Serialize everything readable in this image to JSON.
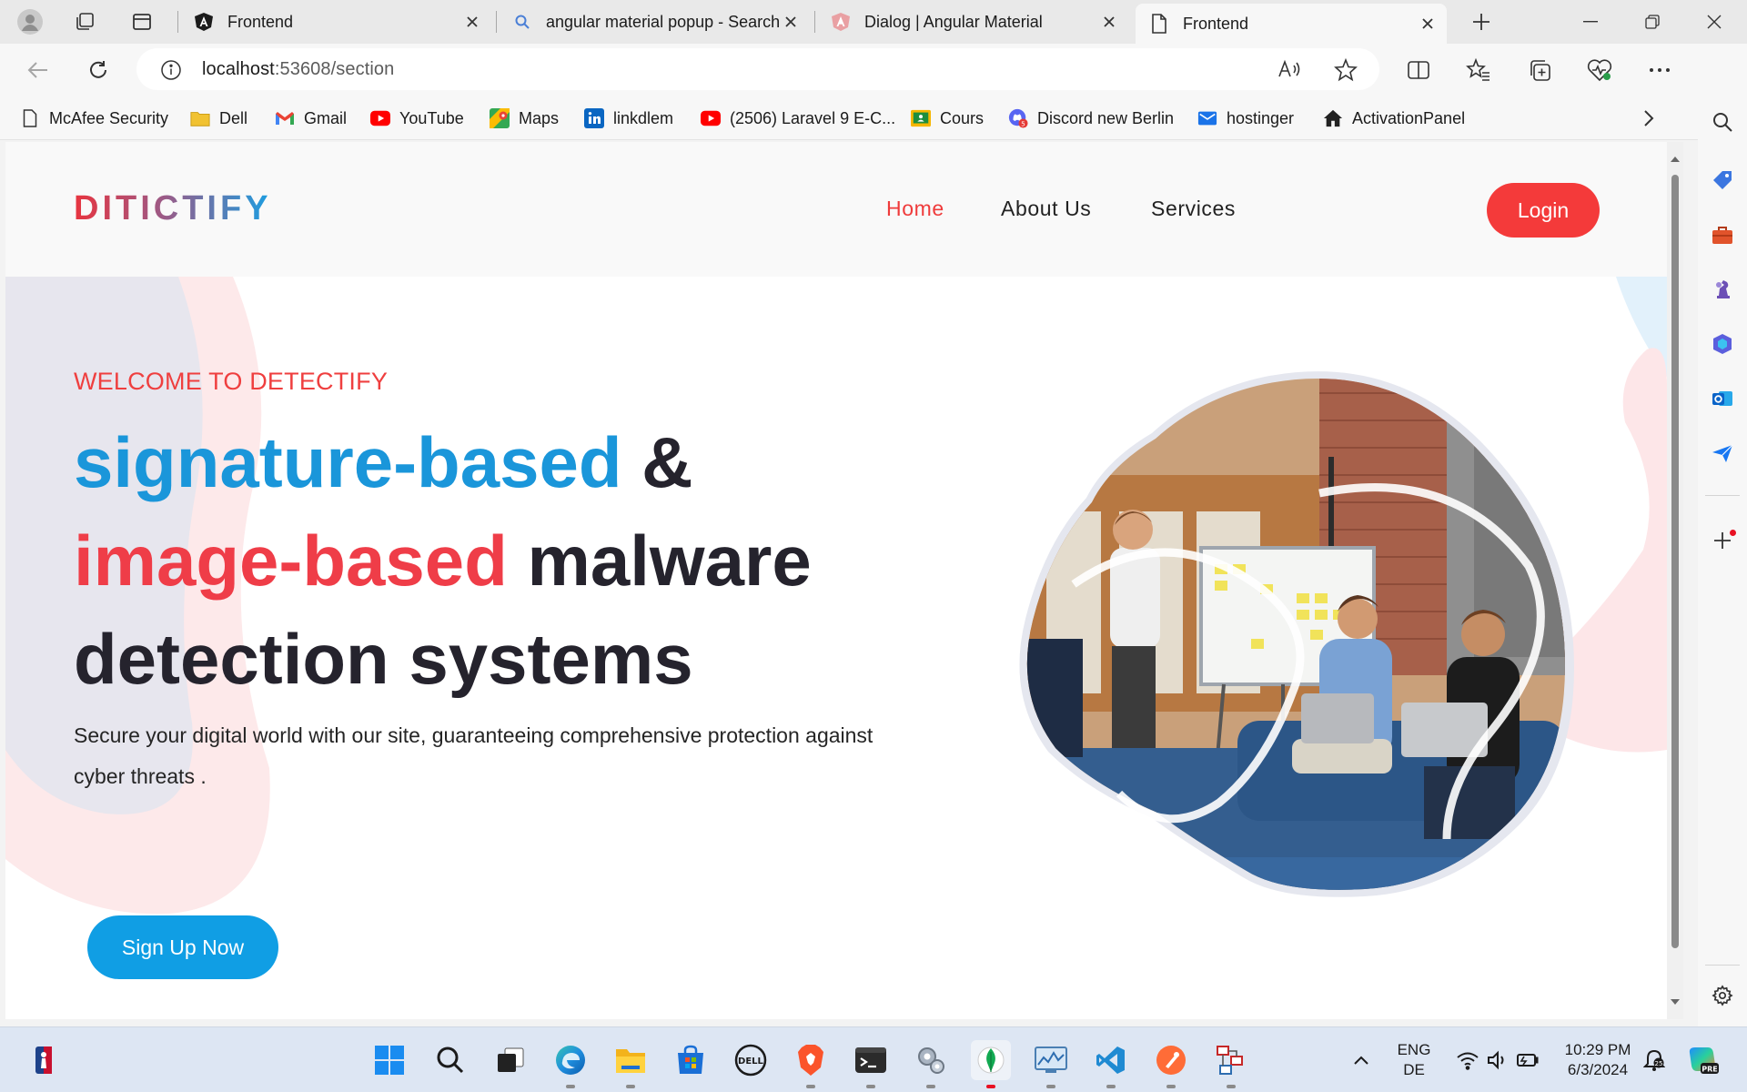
{
  "browser": {
    "tabs": [
      {
        "label": "Frontend",
        "icon": "angular-a-icon",
        "active": false
      },
      {
        "label": "angular material popup - Search",
        "icon": "search-icon",
        "active": false
      },
      {
        "label": "Dialog | Angular Material",
        "icon": "angular-material-icon",
        "active": false
      },
      {
        "label": "Frontend",
        "icon": "page-icon",
        "active": true
      }
    ],
    "address": {
      "host": "localhost",
      "port_path": ":53608/section"
    },
    "favorites": [
      {
        "label": "McAfee Security",
        "icon": "page-icon"
      },
      {
        "label": "Dell",
        "icon": "folder-icon"
      },
      {
        "label": "Gmail",
        "icon": "gmail-icon"
      },
      {
        "label": "YouTube",
        "icon": "youtube-icon"
      },
      {
        "label": "Maps",
        "icon": "maps-icon"
      },
      {
        "label": "linkdlem",
        "icon": "linkedin-icon"
      },
      {
        "label": "(2506) Laravel 9 E-C...",
        "icon": "youtube-icon"
      },
      {
        "label": "Cours",
        "icon": "classroom-icon"
      },
      {
        "label": "Discord new Berlin",
        "icon": "discord-icon"
      },
      {
        "label": "hostinger",
        "icon": "mail-icon"
      },
      {
        "label": "ActivationPanel",
        "icon": "home-icon"
      }
    ]
  },
  "site": {
    "logo": "DITICTIFY",
    "menu": [
      {
        "label": "Home",
        "active": true
      },
      {
        "label": "About Us",
        "active": false
      },
      {
        "label": "Services",
        "active": false
      }
    ],
    "login_label": "Login",
    "welcome": "WELCOME TO DETECTIFY",
    "headline": {
      "part1": "signature-based",
      "part2": " &",
      "part3": "image-based",
      "part4": " malware",
      "part5": "detection systems"
    },
    "subtitle": "Secure your digital world with our site, guaranteeing comprehensive protection against cyber threats .",
    "signup_label": "Sign Up Now",
    "colors": {
      "accent_red": "#f43a3a",
      "accent_blue": "#109ee4",
      "text_dark": "#25232d"
    }
  },
  "taskbar": {
    "language": "ENG",
    "region": "DE",
    "time": "10:29 PM",
    "date": "6/3/2024"
  }
}
